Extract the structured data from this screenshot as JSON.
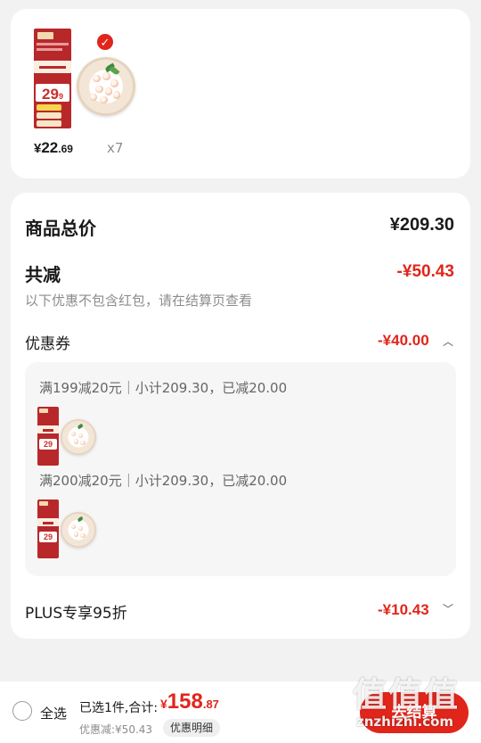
{
  "product": {
    "thumbnail_price_digits": "29",
    "thumbnail_price_suffix": "9",
    "price_symbol": "¥",
    "price_int": "22",
    "price_dec": ".69",
    "quantity": "x7"
  },
  "summary": {
    "total_label": "商品总价",
    "total_value": "¥209.30",
    "reduction_label": "共减",
    "reduction_value": "-¥50.43",
    "note": "以下优惠不包含红包，请在结算页查看",
    "coupon_label": "优惠券",
    "coupon_value": "-¥40.00",
    "coupons": [
      {
        "text": "满199减20元｜小计209.30，已减20.00"
      },
      {
        "text": "满200减20元｜小计209.30，已减20.00"
      }
    ],
    "plus_label": "PLUS专享95折",
    "plus_value": "-¥10.43"
  },
  "bottom_bar": {
    "select_all_label": "全选",
    "selected_info": "已选1件,合计:",
    "total_symbol": "¥",
    "total_int": "158",
    "total_dec": ".87",
    "discount_info": "优惠减:¥50.43",
    "detail_button": "优惠明细",
    "checkout_label": "去结算"
  },
  "watermark": {
    "logo_text": "值值值",
    "url": "znzhizhi.com"
  },
  "colors": {
    "accent_red": "#e1251b",
    "muted_text": "#8c8c8c",
    "background": "#f2f2f2"
  }
}
